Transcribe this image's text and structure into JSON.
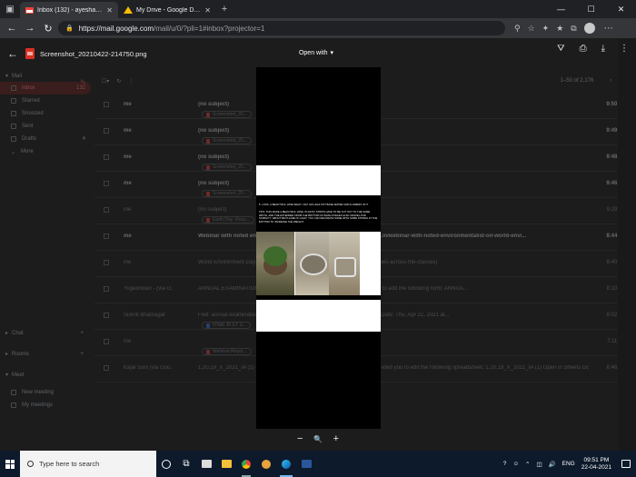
{
  "browser": {
    "tabs": [
      {
        "title": "Inbox (132) - ayesha.khan@thei",
        "active": true
      },
      {
        "title": "My Drive - Google Drive",
        "active": false
      }
    ],
    "url_host": "https://mail.google.com",
    "url_rest": "/mail/u/0/?pli=1#inbox?projector=1"
  },
  "viewer": {
    "file_name": "Screenshot_20210422-214750.png",
    "open_with_label": "Open with",
    "doc_caption": "5. LOOK, A BEAUTIFUL VASE WHAT I DAY HIS LEAF POT BASE WATER AND FLOWERS IN IT.",
    "doc_body": "TIPS: THIS MAKE A BEAUTIFUL VASE. PLASTIC STRIPS HAVE TO BE CUT OUT TO THE SAME WIDTH, AND THE EXTENDED FROM THE BOTTOM OF WHICH PIECES ALSO GRAVEL FOR STABILITY. ABOUT BE PLACED IF LIGHT, YOU CAN DECORATE SOME WITH SOME STONES AT THE BOTTOM TO INCREASE THE WEIGHT.",
    "zoom_out": "−",
    "zoom_reset": "🔍",
    "zoom_in": "+"
  },
  "gmail": {
    "sidebar": [
      {
        "label": "Inbox",
        "count": "132",
        "selected": true
      },
      {
        "label": "Starred",
        "count": "",
        "selected": false
      },
      {
        "label": "Snoozed",
        "count": "",
        "selected": false
      },
      {
        "label": "Sent",
        "count": "",
        "selected": false
      },
      {
        "label": "Drafts",
        "count": "4",
        "selected": false
      },
      {
        "label": "More",
        "count": "",
        "selected": false
      }
    ],
    "sections": {
      "mail": "Mail",
      "chat": "Chat",
      "rooms": "Rooms",
      "meet": "Meet",
      "new_meeting": "New meeting",
      "my_meetings": "My meetings"
    },
    "pagination": "1–50 of 2,176",
    "rows": [
      {
        "sender": "me",
        "subject": "(no subject)",
        "attachment": "Screenshot_20...",
        "time": "9:50 PM",
        "bold": true
      },
      {
        "sender": "me",
        "subject": "(no subject)",
        "attachment": "Screenshot_20...",
        "time": "9:49 PM",
        "bold": true
      },
      {
        "sender": "me",
        "subject": "(no subject)",
        "attachment": "Screenshot_20...",
        "time": "9:48 PM",
        "bold": true
      },
      {
        "sender": "me",
        "subject": "(no subject)",
        "attachment": "Screenshot_20...",
        "time": "9:46 PM",
        "bold": true
      },
      {
        "sender": "me",
        "subject": "(no subject)",
        "attachment": "Earth Day .Reus...",
        "time": "9:29 PM",
        "bold": false
      },
      {
        "sender": "me",
        "subject": "Webinar with noted environmentalist ... School - http://theindianschool.in/webinar-with-noted-environmentalist-on-world-envi...",
        "attachment": "",
        "time": "8:44 PM",
        "bold": true
      },
      {
        "sender": "me",
        "subject": "World Environment Day ... (theindianschool.in/world-environment-day-activities-across-the-classes)",
        "attachment": "",
        "time": "8:40 PM",
        "bold": false
      },
      {
        "sender": "Yogeshwari - (via G.",
        "subject": "ANNUAL EXAMINATION ... yogeshwari@theindianschool.in has invited you to edit the following form: ANNUA...",
        "attachment": "",
        "time": "8:10 PM",
        "bold": false
      },
      {
        "sender": "Sukriti Bhatnagar",
        "subject": "Fwd: annual examination ... Sukriti Bhatnagar <sukriti@theindianschool.in> Date: Thu, Apr 22, 2021 at...",
        "attachment": "FINAL BI ILT S...",
        "time": "8:02 PM",
        "bold": false
      },
      {
        "sender": "me",
        "subject": "",
        "attachment": "Webinar-Repor...",
        "time": "7:11 PM",
        "bold": false
      },
      {
        "sender": "Kajal Soni (via Goo.",
        "subject": "1,20,19_X_2021_IA (1) - Invitation to edit ... Soni@theindianschool.in has invited you to edit the following spreadsheet: 1,20,19_X_2021_IA (1) Open in Sheets Googl...",
        "attachment": "",
        "time": "6:46 PM",
        "bold": false
      }
    ]
  },
  "taskbar": {
    "search_placeholder": "Type here to search",
    "language": "ENG",
    "time": "09:51 PM",
    "date": "22-04-2021"
  },
  "colors": {
    "accent_red": "#d93025",
    "taskbar": "#0d1a2b"
  }
}
